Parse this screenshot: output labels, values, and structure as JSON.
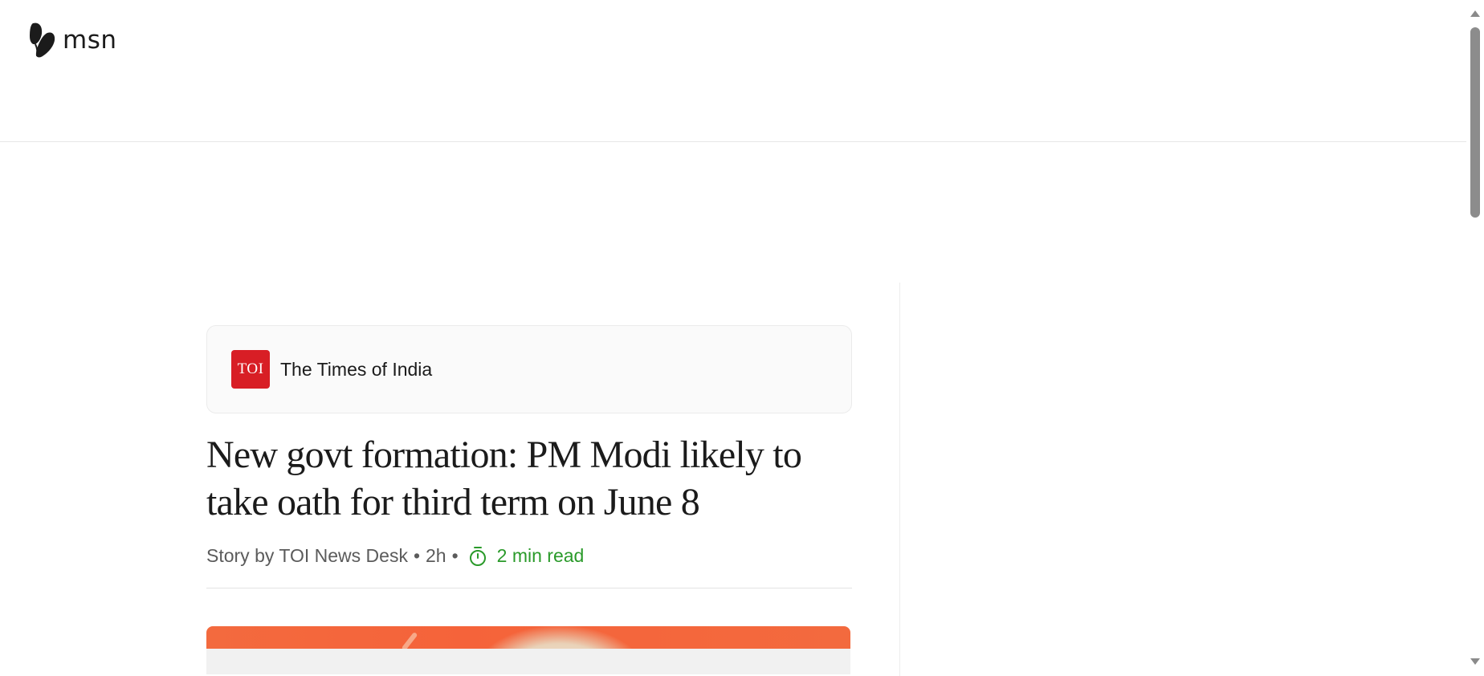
{
  "header": {
    "brand_name": "msn",
    "brand_icon": "butterfly-icon"
  },
  "article": {
    "publisher": {
      "name": "The Times of India",
      "logo_text": "TOI",
      "logo_color": "#d81e25"
    },
    "headline": "New govt formation: PM Modi likely to take oath for third term on June 8",
    "byline": {
      "story_by": "Story by TOI News Desk",
      "age": "2h",
      "separator": "•",
      "read_time": "2 min read",
      "read_time_icon": "timer-icon",
      "read_time_color": "#2a9a2a"
    },
    "hero_image": {
      "dominant_color": "#f36a3e"
    }
  },
  "scrollbar": {
    "up_icon": "scroll-up-arrow-icon",
    "down_icon": "scroll-down-arrow-icon"
  }
}
